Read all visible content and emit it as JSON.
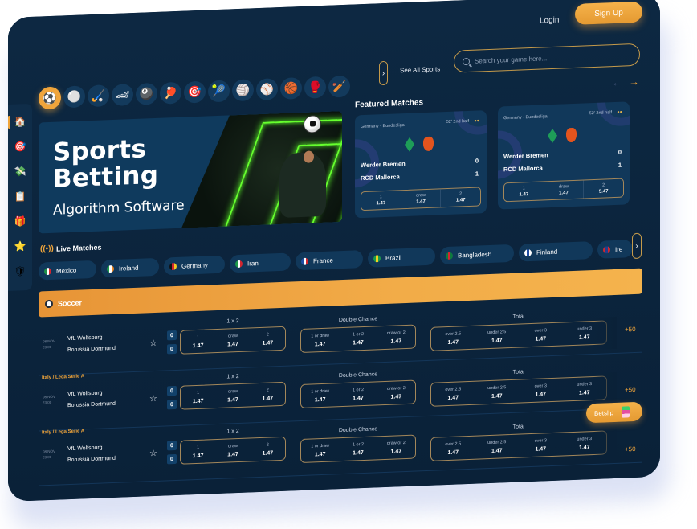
{
  "header": {
    "login_label": "Login",
    "signup_label": "Sign Up"
  },
  "sidebar": {
    "items": [
      {
        "name": "home",
        "glyph": "🏠"
      },
      {
        "name": "live-betting",
        "glyph": "🎯"
      },
      {
        "name": "promotions",
        "glyph": "💸"
      },
      {
        "name": "results",
        "glyph": "📋"
      },
      {
        "name": "bonus",
        "glyph": "🎁"
      },
      {
        "name": "favorites",
        "glyph": "⭐"
      },
      {
        "name": "sports-shield",
        "glyph": "🛡"
      }
    ]
  },
  "sports": {
    "items": [
      {
        "name": "soccer",
        "glyph": "⚽"
      },
      {
        "name": "golf",
        "glyph": "⚪"
      },
      {
        "name": "hockey",
        "glyph": "🏑"
      },
      {
        "name": "motorsport",
        "glyph": "🏎"
      },
      {
        "name": "billiards",
        "glyph": "🎱"
      },
      {
        "name": "table-tennis",
        "glyph": "🏓"
      },
      {
        "name": "darts",
        "glyph": "🎯"
      },
      {
        "name": "tennis",
        "glyph": "🎾"
      },
      {
        "name": "volleyball",
        "glyph": "🏐"
      },
      {
        "name": "baseball",
        "glyph": "⚾"
      },
      {
        "name": "basketball",
        "glyph": "🏀"
      },
      {
        "name": "boxing",
        "glyph": "🥊"
      },
      {
        "name": "cricket",
        "glyph": "🏏"
      }
    ],
    "next_glyph": "›",
    "see_all_label": "See All Sports"
  },
  "search": {
    "placeholder": "Search your game here...."
  },
  "nav_arrows": {
    "prev": "←",
    "next": "→"
  },
  "banner": {
    "title_line1": "Sports",
    "title_line2": "Betting",
    "subtitle": "Algorithm Software"
  },
  "featured": {
    "title": "Featured Matches",
    "cards": [
      {
        "league": "Germany - Bundesliga",
        "time": "52' 2nd half",
        "live_mark": "●●",
        "home": "Werder Bremen",
        "away": "RCD Mallorca",
        "home_score": "0",
        "away_score": "1",
        "odds": [
          {
            "label": "1",
            "value": "1.47"
          },
          {
            "label": "draw",
            "value": "1.47"
          },
          {
            "label": "2",
            "value": "1.47"
          }
        ]
      },
      {
        "league": "Germany - Bundesliga",
        "time": "52' 2nd half",
        "live_mark": "●●",
        "home": "Werder Bremen",
        "away": "RCD Mallorca",
        "home_score": "0",
        "away_score": "1",
        "odds": [
          {
            "label": "1",
            "value": "1.47"
          },
          {
            "label": "draw",
            "value": "1.47"
          },
          {
            "label": "2",
            "value": "5.47"
          }
        ]
      }
    ]
  },
  "live": {
    "title": "Live Matches",
    "icon_glyph": "((•))",
    "countries": [
      {
        "name": "Mexico",
        "colors": [
          "#1d8f48",
          "#ffffff",
          "#d3262f"
        ]
      },
      {
        "name": "Ireland",
        "colors": [
          "#1d9a4a",
          "#ffffff",
          "#f08a24"
        ]
      },
      {
        "name": "Germany",
        "colors": [
          "#111111",
          "#d3262f",
          "#f3c623"
        ]
      },
      {
        "name": "Iran",
        "colors": [
          "#1d9a4a",
          "#ffffff",
          "#d3262f"
        ]
      },
      {
        "name": "France",
        "colors": [
          "#1f4ea3",
          "#ffffff",
          "#d3262f"
        ]
      },
      {
        "name": "Brazil",
        "colors": [
          "#1d9a4a",
          "#f3d023",
          "#1d9a4a"
        ]
      },
      {
        "name": "Bangladesh",
        "colors": [
          "#0f7a3f",
          "#d3262f",
          "#0f7a3f"
        ]
      },
      {
        "name": "Finland",
        "colors": [
          "#ffffff",
          "#1f4ea3",
          "#ffffff"
        ]
      },
      {
        "name": "Ire",
        "colors": [
          "#d3262f",
          "#1f3f8f",
          "#d3262f"
        ]
      }
    ],
    "next_glyph": "›"
  },
  "section": {
    "title": "Soccer"
  },
  "matches": [
    {
      "league": "",
      "date": "08 NOV",
      "time": "23:00",
      "home": "VfL Wolfsburg",
      "away": "Borussia Dortmund",
      "home_score": "0",
      "away_score": "0",
      "one_x_two": {
        "title": "1 x 2",
        "cells": [
          {
            "label": "1",
            "value": "1.47"
          },
          {
            "label": "draw",
            "value": "1.47"
          },
          {
            "label": "2",
            "value": "1.47"
          }
        ]
      },
      "double_chance": {
        "title": "Double Chance",
        "cells": [
          {
            "label": "1 or draw",
            "value": "1.47"
          },
          {
            "label": "1 or 2",
            "value": "1.47"
          },
          {
            "label": "draw or 2",
            "value": "1.47"
          }
        ]
      },
      "total": {
        "title": "Total",
        "cells": [
          {
            "label": "over 2.5",
            "value": "1.47"
          },
          {
            "label": "under 2.5",
            "value": "1.47"
          },
          {
            "label": "over 3",
            "value": "1.47"
          },
          {
            "label": "under 3",
            "value": "1.47"
          }
        ]
      },
      "more": "+50"
    },
    {
      "league": "Italy / Lega Serie A",
      "date": "08 NOV",
      "time": "23:00",
      "home": "VfL Wolfsburg",
      "away": "Borussia Dortmund",
      "home_score": "0",
      "away_score": "0",
      "one_x_two": {
        "title": "1 x 2",
        "cells": [
          {
            "label": "1",
            "value": "1.47"
          },
          {
            "label": "draw",
            "value": "1.47"
          },
          {
            "label": "2",
            "value": "1.47"
          }
        ]
      },
      "double_chance": {
        "title": "Double Chance",
        "cells": [
          {
            "label": "1 or draw",
            "value": "1.47"
          },
          {
            "label": "1 or 2",
            "value": "1.47"
          },
          {
            "label": "draw or 2",
            "value": "1.47"
          }
        ]
      },
      "total": {
        "title": "Total",
        "cells": [
          {
            "label": "over 2.5",
            "value": "1.47"
          },
          {
            "label": "under 2.5",
            "value": "1.47"
          },
          {
            "label": "over 3",
            "value": "1.47"
          },
          {
            "label": "under 3",
            "value": "1.47"
          }
        ]
      },
      "more": "+50"
    },
    {
      "league": "Italy / Lega Serie A",
      "date": "08 NOV",
      "time": "23:00",
      "home": "VfL Wolfsburg",
      "away": "Borussia Dortmund",
      "home_score": "0",
      "away_score": "0",
      "one_x_two": {
        "title": "1 x 2",
        "cells": [
          {
            "label": "1",
            "value": "1.47"
          },
          {
            "label": "draw",
            "value": "1.47"
          },
          {
            "label": "2",
            "value": "1.47"
          }
        ]
      },
      "double_chance": {
        "title": "Double Chance",
        "cells": [
          {
            "label": "1 or draw",
            "value": "1.47"
          },
          {
            "label": "1 or 2",
            "value": "1.47"
          },
          {
            "label": "draw or 2",
            "value": "1.47"
          }
        ]
      },
      "total": {
        "title": "Total",
        "cells": [
          {
            "label": "over 2.5",
            "value": "1.47"
          },
          {
            "label": "under 2.5",
            "value": "1.47"
          },
          {
            "label": "over 3",
            "value": "1.47"
          },
          {
            "label": "under 3",
            "value": "1.47"
          }
        ]
      },
      "more": "+50"
    }
  ],
  "betslip": {
    "label": "Betslip"
  },
  "colors": {
    "accent": "#f0a53b",
    "background": "#0b2540",
    "card": "#11385a",
    "border_gold": "#a3875a"
  }
}
